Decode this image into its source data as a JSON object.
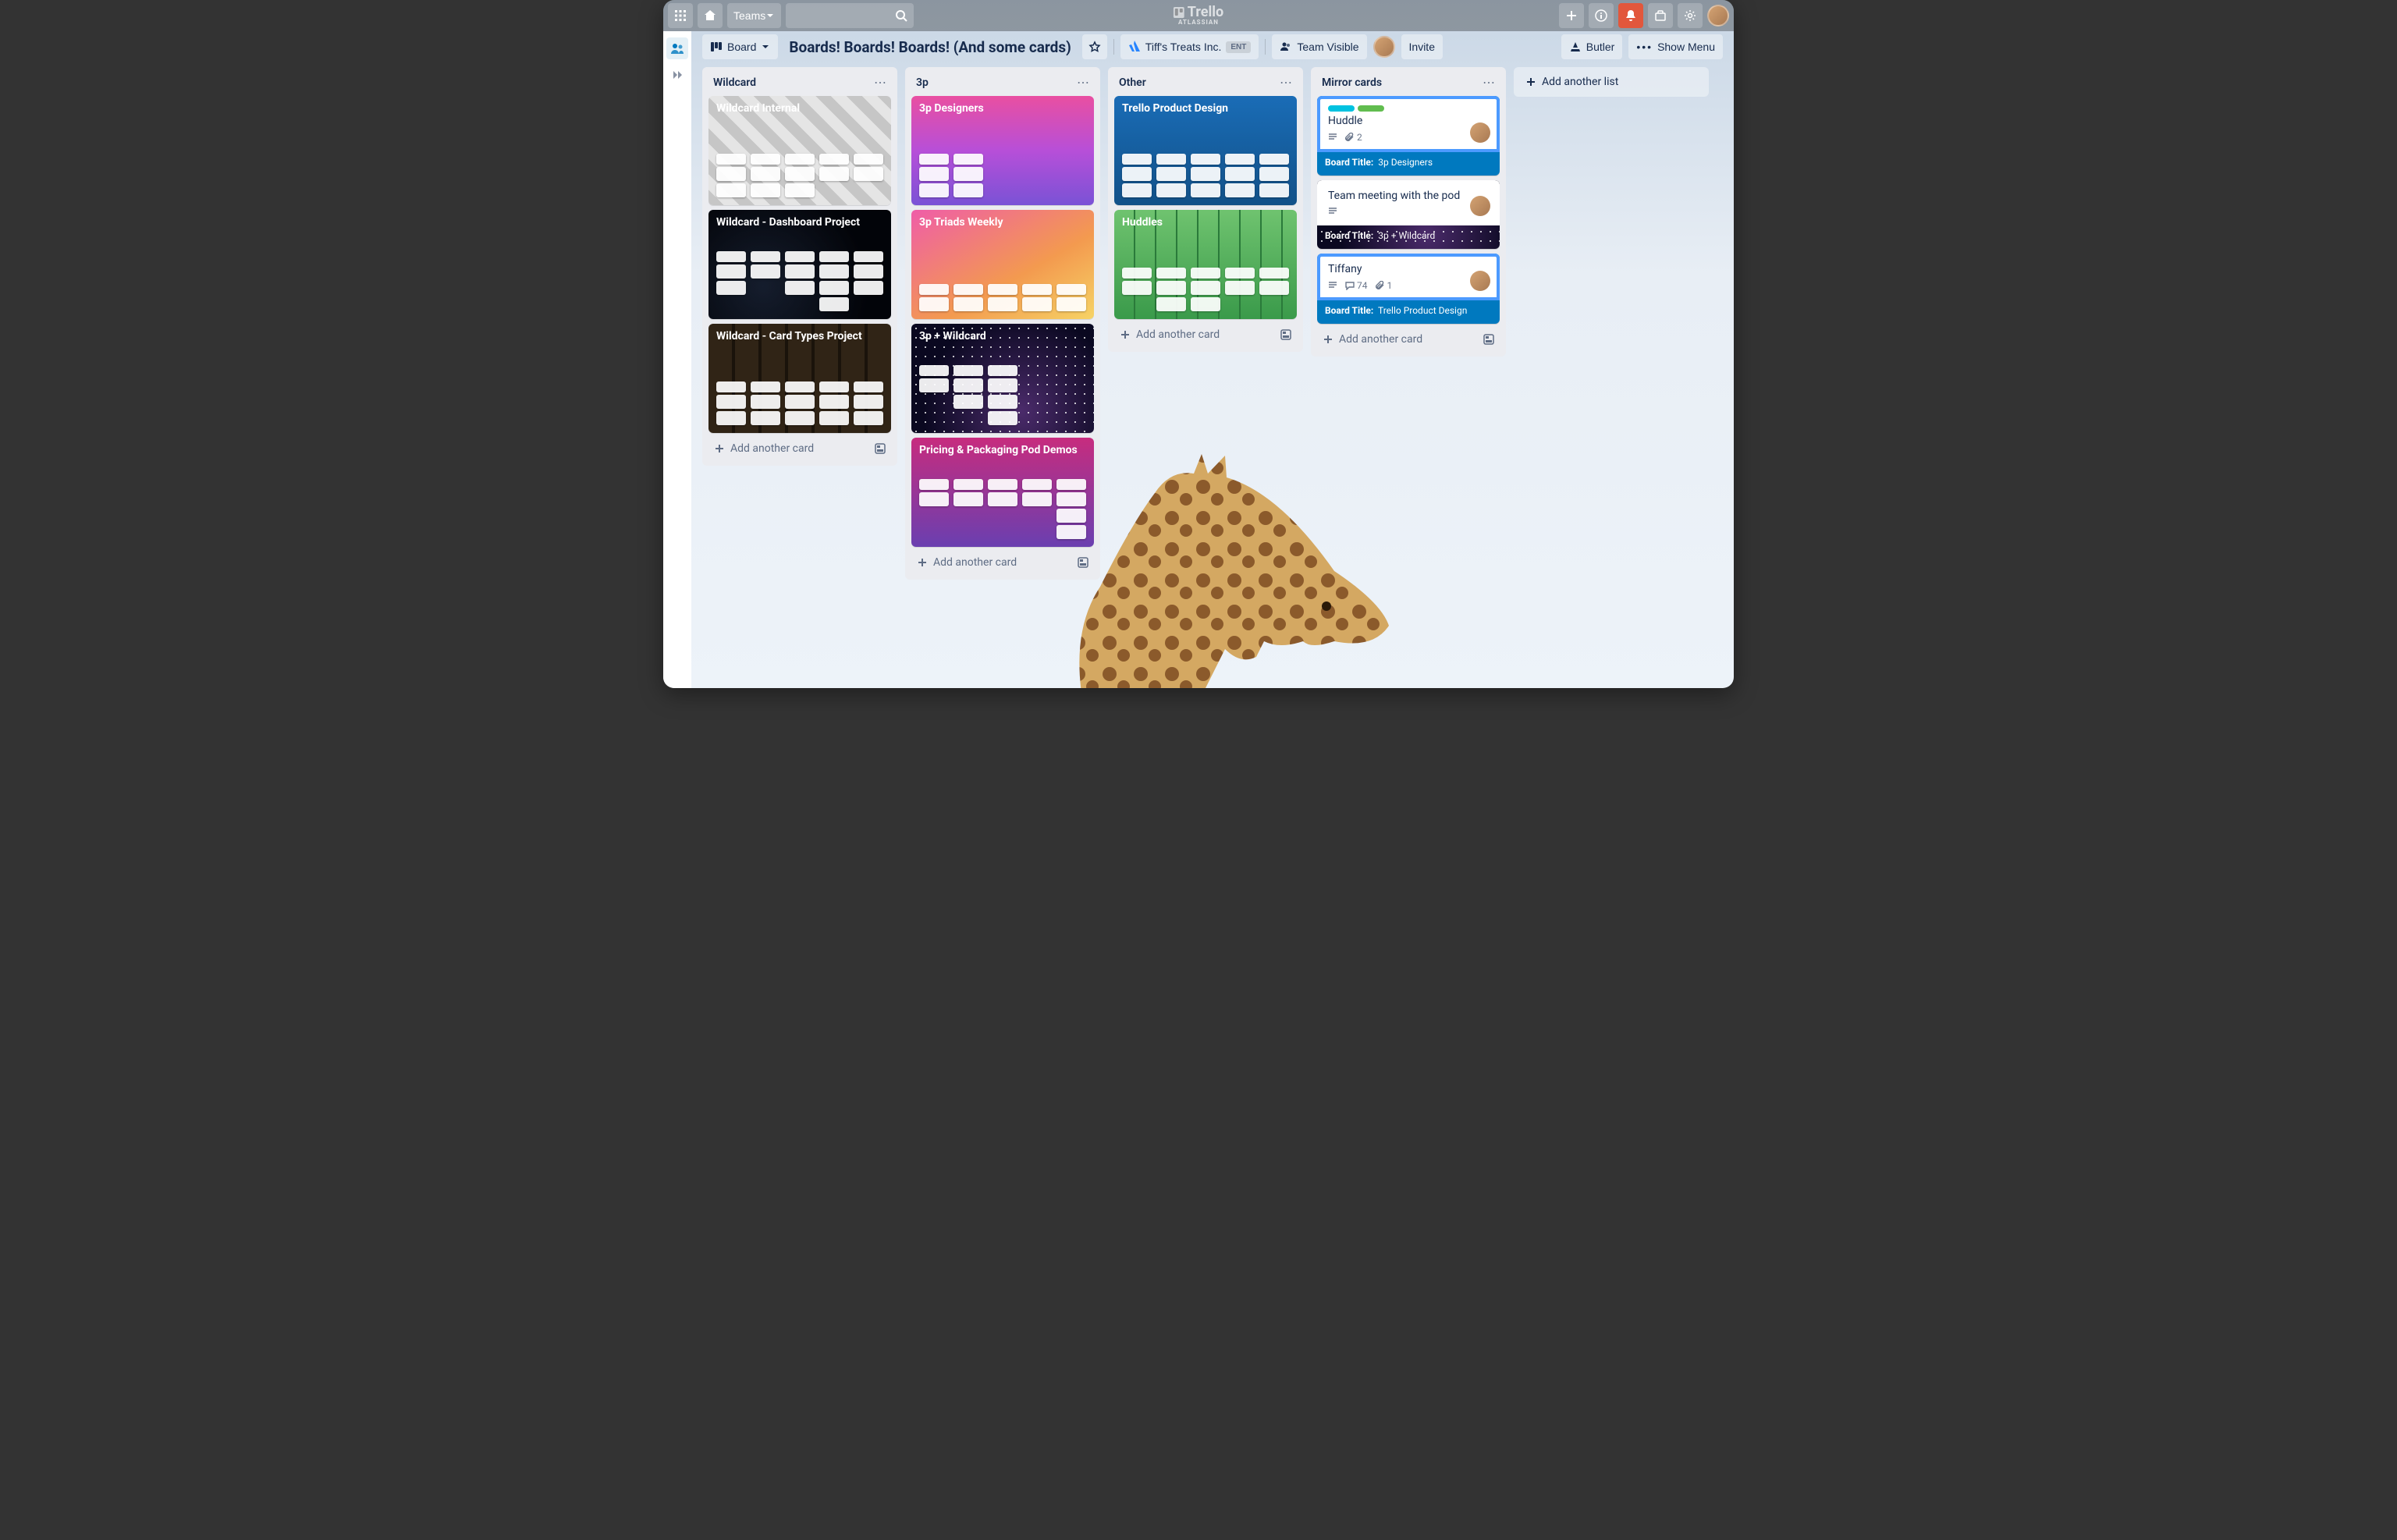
{
  "header": {
    "teams_label": "Teams",
    "logo_top": "Trello",
    "logo_bottom": "ATLASSIAN"
  },
  "board_bar": {
    "view": "Board",
    "title": "Boards! Boards! Boards! (And some cards)",
    "workspace": "Tiff's Treats Inc.",
    "workspace_badge": "ENT",
    "visibility": "Team Visible",
    "invite": "Invite",
    "butler": "Butler",
    "show_menu": "Show Menu"
  },
  "lists": [
    {
      "title": "Wildcard",
      "add_card": "Add another card",
      "cards": [
        {
          "title": "Wildcard Internal",
          "bg": "photo-cards",
          "cols": [
            2,
            2,
            2,
            1,
            1
          ]
        },
        {
          "title": "Wildcard - Dashboard Project",
          "bg": "city-night",
          "cols": [
            2,
            1,
            2,
            3,
            2
          ]
        },
        {
          "title": "Wildcard - Card Types Project",
          "bg": "gallery",
          "cols": [
            2,
            2,
            2,
            2,
            2
          ]
        }
      ]
    },
    {
      "title": "3p",
      "add_card": "Add another card",
      "cards": [
        {
          "title": "3p Designers",
          "bg": "pink-purple",
          "cols": [
            2,
            2
          ]
        },
        {
          "title": "3p Triads Weekly",
          "bg": "pink-yellow",
          "cols": [
            1,
            1,
            1,
            1,
            1
          ]
        },
        {
          "title": "3p + Wildcard",
          "bg": "stars",
          "cols": [
            1,
            2,
            3
          ]
        },
        {
          "title": "Pricing & Packaging Pod Demos",
          "bg": "magenta-purple",
          "cols": [
            1,
            1,
            1,
            1,
            3
          ]
        }
      ]
    },
    {
      "title": "Other",
      "add_card": "Add another card",
      "cards": [
        {
          "title": "Trello Product Design",
          "bg": "blue-team",
          "cols": [
            2,
            2,
            2,
            2,
            2
          ]
        },
        {
          "title": "Huddles",
          "bg": "trees",
          "cols": [
            1,
            2,
            2,
            1,
            1
          ]
        }
      ]
    },
    {
      "title": "Mirror cards",
      "add_card": "Add another card",
      "mirror_cards": [
        {
          "title": "Huddle",
          "labels": [
            {
              "w": 34,
              "c": "#00c2e0"
            },
            {
              "w": 34,
              "c": "#61bd4f"
            }
          ],
          "badges": {
            "description": true,
            "attachments": "2"
          },
          "board_title_label": "Board Title:",
          "board_title_value": "3p Designers",
          "frame": "#4c9aff",
          "footer_bg": "#0079bf"
        },
        {
          "title": "Team meeting with the pod",
          "labels": [],
          "badges": {
            "description": true
          },
          "board_title_label": "Board Title:",
          "board_title_value": "3p + Wildcard",
          "frame": "#fff",
          "footer_bg_image": "stars"
        },
        {
          "title": "Tiffany",
          "labels": [],
          "badges": {
            "description": true,
            "comments": "74",
            "attachments": "1"
          },
          "board_title_label": "Board Title:",
          "board_title_value": "Trello Product Design",
          "frame": "#4c9aff",
          "footer_bg": "#0079bf"
        }
      ]
    }
  ],
  "add_list": "Add another list"
}
